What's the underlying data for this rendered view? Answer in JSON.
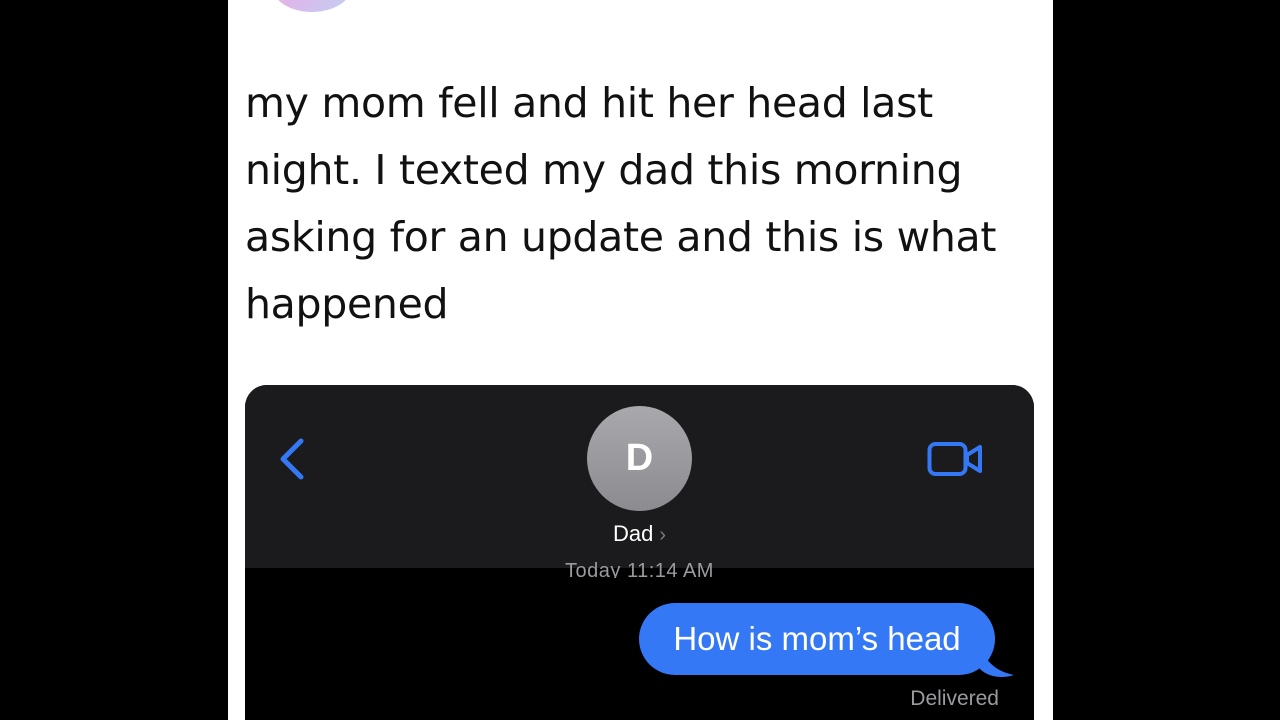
{
  "tweet": {
    "text": "my mom fell and hit her head last night. I texted my dad this morning asking for an update and this is what happened"
  },
  "messages_screenshot": {
    "header": {
      "back_icon": "chevron-left-icon",
      "contact_initial": "D",
      "contact_name": "Dad",
      "contact_chevron": "›",
      "video_icon": "video-camera-icon"
    },
    "timestamp": "Today 11:14 AM",
    "messages": [
      {
        "sender": "me",
        "text": "How is mom’s head",
        "status": "Delivered"
      }
    ]
  },
  "colors": {
    "background": "#000000",
    "post_background": "#ffffff",
    "header_background": "#1b1b1d",
    "accent_blue": "#3478f6",
    "meta_gray": "#9a9a9f"
  }
}
